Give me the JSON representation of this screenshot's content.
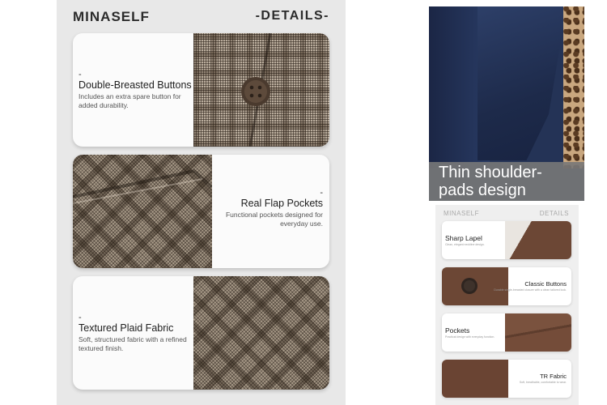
{
  "main_panel": {
    "brand": "MINASELF",
    "details_heading": "-DETAILS-",
    "cards": [
      {
        "dash": "-",
        "title": "Double-Breasted Buttons",
        "desc": "Includes an extra spare button for added durability."
      },
      {
        "dash": "-",
        "title": "Real Flap Pockets",
        "desc": "Functional pockets designed for everyday use."
      },
      {
        "dash": "-",
        "title": "Textured Plaid Fabric",
        "desc": "Soft, structured fabric with a refined textured finish."
      }
    ]
  },
  "blazer_photo": {
    "caption": "Thin shoulder-pads design"
  },
  "mini_panel": {
    "brand": "MINASELF",
    "details_heading": "DETAILS",
    "cards": [
      {
        "title": "Sharp Lapel",
        "desc": "Clean, elegant neckline design."
      },
      {
        "title": "Classic Buttons",
        "desc": "Durable single-breasted closure with a clean tailored look."
      },
      {
        "title": "Pockets",
        "desc": "Practical design with everyday function."
      },
      {
        "title": "TR Fabric",
        "desc": "Soft, breathable, comfortable to wear."
      }
    ]
  },
  "colors": {
    "panel_bg": "#e8e8e8",
    "navy": "#243356",
    "brown": "#6c4735",
    "caption_bg": "#787878"
  }
}
